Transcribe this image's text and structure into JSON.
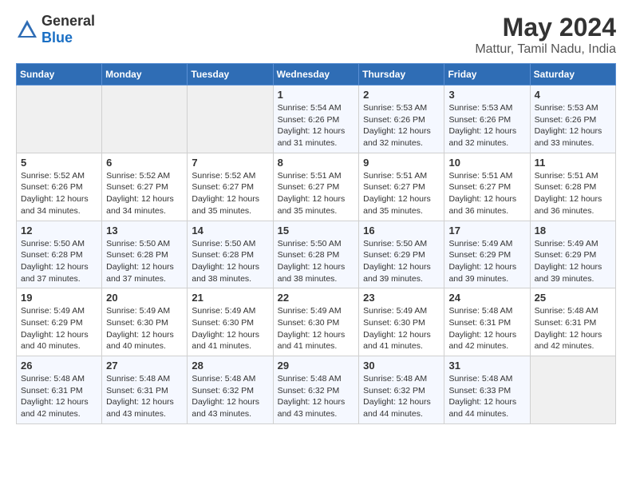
{
  "logo": {
    "general": "General",
    "blue": "Blue"
  },
  "title": "May 2024",
  "subtitle": "Mattur, Tamil Nadu, India",
  "weekdays": [
    "Sunday",
    "Monday",
    "Tuesday",
    "Wednesday",
    "Thursday",
    "Friday",
    "Saturday"
  ],
  "weeks": [
    [
      {
        "day": "",
        "info": ""
      },
      {
        "day": "",
        "info": ""
      },
      {
        "day": "",
        "info": ""
      },
      {
        "day": "1",
        "info": "Sunrise: 5:54 AM\nSunset: 6:26 PM\nDaylight: 12 hours\nand 31 minutes."
      },
      {
        "day": "2",
        "info": "Sunrise: 5:53 AM\nSunset: 6:26 PM\nDaylight: 12 hours\nand 32 minutes."
      },
      {
        "day": "3",
        "info": "Sunrise: 5:53 AM\nSunset: 6:26 PM\nDaylight: 12 hours\nand 32 minutes."
      },
      {
        "day": "4",
        "info": "Sunrise: 5:53 AM\nSunset: 6:26 PM\nDaylight: 12 hours\nand 33 minutes."
      }
    ],
    [
      {
        "day": "5",
        "info": "Sunrise: 5:52 AM\nSunset: 6:26 PM\nDaylight: 12 hours\nand 34 minutes."
      },
      {
        "day": "6",
        "info": "Sunrise: 5:52 AM\nSunset: 6:27 PM\nDaylight: 12 hours\nand 34 minutes."
      },
      {
        "day": "7",
        "info": "Sunrise: 5:52 AM\nSunset: 6:27 PM\nDaylight: 12 hours\nand 35 minutes."
      },
      {
        "day": "8",
        "info": "Sunrise: 5:51 AM\nSunset: 6:27 PM\nDaylight: 12 hours\nand 35 minutes."
      },
      {
        "day": "9",
        "info": "Sunrise: 5:51 AM\nSunset: 6:27 PM\nDaylight: 12 hours\nand 35 minutes."
      },
      {
        "day": "10",
        "info": "Sunrise: 5:51 AM\nSunset: 6:27 PM\nDaylight: 12 hours\nand 36 minutes."
      },
      {
        "day": "11",
        "info": "Sunrise: 5:51 AM\nSunset: 6:28 PM\nDaylight: 12 hours\nand 36 minutes."
      }
    ],
    [
      {
        "day": "12",
        "info": "Sunrise: 5:50 AM\nSunset: 6:28 PM\nDaylight: 12 hours\nand 37 minutes."
      },
      {
        "day": "13",
        "info": "Sunrise: 5:50 AM\nSunset: 6:28 PM\nDaylight: 12 hours\nand 37 minutes."
      },
      {
        "day": "14",
        "info": "Sunrise: 5:50 AM\nSunset: 6:28 PM\nDaylight: 12 hours\nand 38 minutes."
      },
      {
        "day": "15",
        "info": "Sunrise: 5:50 AM\nSunset: 6:28 PM\nDaylight: 12 hours\nand 38 minutes."
      },
      {
        "day": "16",
        "info": "Sunrise: 5:50 AM\nSunset: 6:29 PM\nDaylight: 12 hours\nand 39 minutes."
      },
      {
        "day": "17",
        "info": "Sunrise: 5:49 AM\nSunset: 6:29 PM\nDaylight: 12 hours\nand 39 minutes."
      },
      {
        "day": "18",
        "info": "Sunrise: 5:49 AM\nSunset: 6:29 PM\nDaylight: 12 hours\nand 39 minutes."
      }
    ],
    [
      {
        "day": "19",
        "info": "Sunrise: 5:49 AM\nSunset: 6:29 PM\nDaylight: 12 hours\nand 40 minutes."
      },
      {
        "day": "20",
        "info": "Sunrise: 5:49 AM\nSunset: 6:30 PM\nDaylight: 12 hours\nand 40 minutes."
      },
      {
        "day": "21",
        "info": "Sunrise: 5:49 AM\nSunset: 6:30 PM\nDaylight: 12 hours\nand 41 minutes."
      },
      {
        "day": "22",
        "info": "Sunrise: 5:49 AM\nSunset: 6:30 PM\nDaylight: 12 hours\nand 41 minutes."
      },
      {
        "day": "23",
        "info": "Sunrise: 5:49 AM\nSunset: 6:30 PM\nDaylight: 12 hours\nand 41 minutes."
      },
      {
        "day": "24",
        "info": "Sunrise: 5:48 AM\nSunset: 6:31 PM\nDaylight: 12 hours\nand 42 minutes."
      },
      {
        "day": "25",
        "info": "Sunrise: 5:48 AM\nSunset: 6:31 PM\nDaylight: 12 hours\nand 42 minutes."
      }
    ],
    [
      {
        "day": "26",
        "info": "Sunrise: 5:48 AM\nSunset: 6:31 PM\nDaylight: 12 hours\nand 42 minutes."
      },
      {
        "day": "27",
        "info": "Sunrise: 5:48 AM\nSunset: 6:31 PM\nDaylight: 12 hours\nand 43 minutes."
      },
      {
        "day": "28",
        "info": "Sunrise: 5:48 AM\nSunset: 6:32 PM\nDaylight: 12 hours\nand 43 minutes."
      },
      {
        "day": "29",
        "info": "Sunrise: 5:48 AM\nSunset: 6:32 PM\nDaylight: 12 hours\nand 43 minutes."
      },
      {
        "day": "30",
        "info": "Sunrise: 5:48 AM\nSunset: 6:32 PM\nDaylight: 12 hours\nand 44 minutes."
      },
      {
        "day": "31",
        "info": "Sunrise: 5:48 AM\nSunset: 6:33 PM\nDaylight: 12 hours\nand 44 minutes."
      },
      {
        "day": "",
        "info": ""
      }
    ]
  ]
}
